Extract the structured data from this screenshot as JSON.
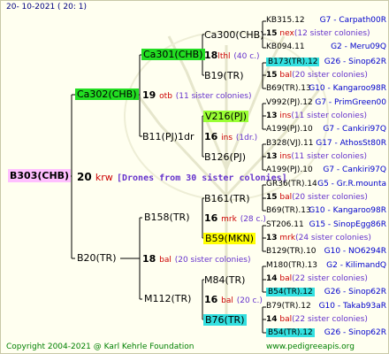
{
  "header_date": "20-  10-2021  (  20:   1)",
  "footer": {
    "copyright": "Copyright 2004-2021 @ Karl Kehrle Foundation",
    "site": "www.pedigreeapis.org"
  },
  "root": {
    "name": "B303(CHB)",
    "num": "20",
    "code": "krw",
    "note": "[Drones from 30 sister colonies]"
  },
  "gen1": [
    {
      "name": "Ca302(CHB)",
      "num": "19",
      "code": "otb",
      "note": "(11 sister colonies)"
    },
    {
      "name": "B20(TR)",
      "num": "18",
      "code": "bal",
      "note": "(20 sister colonies)"
    }
  ],
  "gen2": [
    {
      "name": "Ca301(CHB)",
      "num": "18",
      "code": "lthl",
      "note": "(40 c.)"
    },
    {
      "name": "B11(PJ)1dr",
      "num": "16",
      "code": "ins",
      "note": "(1dr.)"
    },
    {
      "name": "B158(TR)",
      "num": "16",
      "code": "mrk",
      "note": "(28 c.)"
    },
    {
      "name": "M112(TR)",
      "num": "16",
      "code": "bal",
      "note": "(20 c.)"
    }
  ],
  "gen3": [
    {
      "name": "Ca300(CHB)"
    },
    {
      "name": "B19(TR)"
    },
    {
      "name": "V216(PJ)"
    },
    {
      "name": "B126(PJ)"
    },
    {
      "name": "B161(TR)"
    },
    {
      "name": "B59(MKN)"
    },
    {
      "name": "M84(TR)"
    },
    {
      "name": "B76(TR)"
    }
  ],
  "gen4": [
    {
      "left": "KB315.12",
      "right": "G7 - Carpath00R"
    },
    {
      "num": "15",
      "code": "nex",
      "note": "(12 sister colonies)"
    },
    {
      "left": "KB094.11",
      "right": "G2 - Meru09Q"
    },
    {
      "left": "B173(TR).12",
      "right": "G26 - Sinop62R"
    },
    {
      "num": "15",
      "code": "bal",
      "note": "(20 sister colonies)"
    },
    {
      "left": "B69(TR).13",
      "right": "G10 - Kangaroo98R"
    },
    {
      "left": "V992(PJ).12",
      "right": "G7 - PrimGreen00"
    },
    {
      "num": "13",
      "code": "ins",
      "note": "(11 sister colonies)"
    },
    {
      "left": "A199(PJ).10",
      "right": "G7 - Cankiri97Q"
    },
    {
      "left": "B328(VJ).11",
      "right": "G17 - AthosSt80R"
    },
    {
      "num": "13",
      "code": "ins",
      "note": "(11 sister colonies)"
    },
    {
      "left": "A199(PJ).10",
      "right": "G7 - Cankiri97Q"
    },
    {
      "left": "GR36(TR).14",
      "right": "G5 - Gr.R.mounta"
    },
    {
      "num": "15",
      "code": "bal",
      "note": "(20 sister colonies)"
    },
    {
      "left": "B69(TR).13",
      "right": "G10 - Kangaroo98R"
    },
    {
      "left": "ST206.11",
      "right": "G15 - SinopEgg86R"
    },
    {
      "num": "13",
      "code": "mrk",
      "note": "(24 sister colonies)"
    },
    {
      "left": "B129(TR).10",
      "right": "G10 - NO6294R"
    },
    {
      "left": "M180(TR).13",
      "right": "G2 - KilimandQ"
    },
    {
      "num": "14",
      "code": "bal",
      "note": "(22 sister colonies)"
    },
    {
      "left": "B54(TR).12",
      "right": "G26 - Sinop62R"
    },
    {
      "left": "B79(TR).12",
      "right": "G10 - Takab93aR"
    },
    {
      "num": "14",
      "code": "bal",
      "note": "(22 sister colonies)"
    },
    {
      "left": "B54(TR).12",
      "right": "G26 - Sinop62R"
    }
  ],
  "colors": {
    "highlight_green": "#22dd22",
    "highlight_lime": "#99ff33",
    "highlight_yellow": "#ffff00",
    "highlight_cyan": "#33e0e0",
    "root_bg": "#ffc0ff"
  }
}
